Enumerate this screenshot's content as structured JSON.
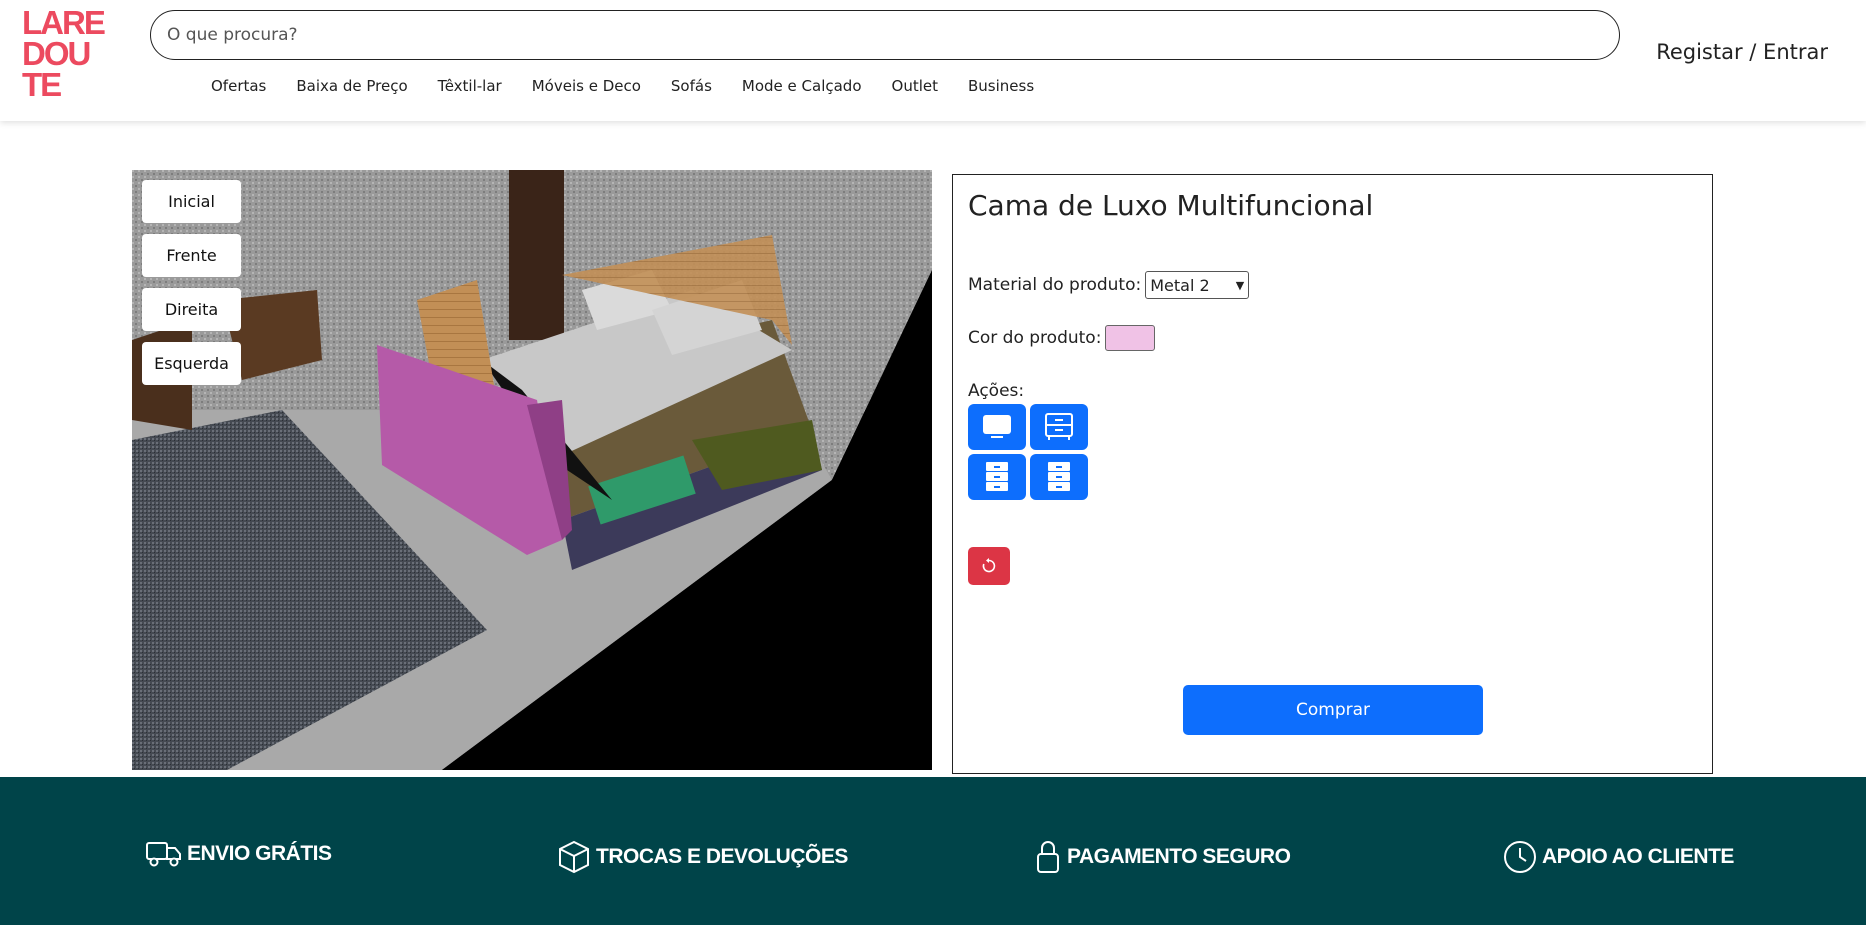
{
  "header": {
    "logo_lines": [
      "LARE",
      "DOU",
      "TE"
    ],
    "search_placeholder": "O que procura?",
    "nav": [
      "Ofertas",
      "Baixa de Preço",
      "Têxtil-lar",
      "Móveis e Deco",
      "Sofás",
      "Mode e Calçado",
      "Outlet",
      "Business"
    ],
    "register": "Registar",
    "separator": " / ",
    "login": "Entrar"
  },
  "viewer": {
    "camera_buttons": [
      "Inicial",
      "Frente",
      "Direita",
      "Esquerda"
    ]
  },
  "product": {
    "title": "Cama de Luxo Multifuncional",
    "material_label": "Material do produto:",
    "material_value": "Metal 2",
    "color_label": "Cor do produto:",
    "color_value": "#f0c2e6",
    "actions_label": "Ações:",
    "action_icons": [
      "tv-icon",
      "nightstand-icon",
      "drawer-cabinet-icon",
      "drawer-cabinet-icon"
    ],
    "reset_icon": "reset-icon",
    "buy_label": "Comprar"
  },
  "footer": {
    "features": [
      {
        "icon": "truck-icon",
        "label": "ENVIO GRÁTIS"
      },
      {
        "icon": "box-icon",
        "label": "TROCAS E DEVOLUÇÕES"
      },
      {
        "icon": "lock-icon",
        "label": "PAGAMENTO SEGURO"
      },
      {
        "icon": "clock-icon",
        "label": "APOIO AO CLIENTE"
      }
    ]
  },
  "colors": {
    "brand": "#ec4a5f",
    "primary": "#0d6efd",
    "danger": "#dc3545",
    "footer_bg": "#004449"
  }
}
